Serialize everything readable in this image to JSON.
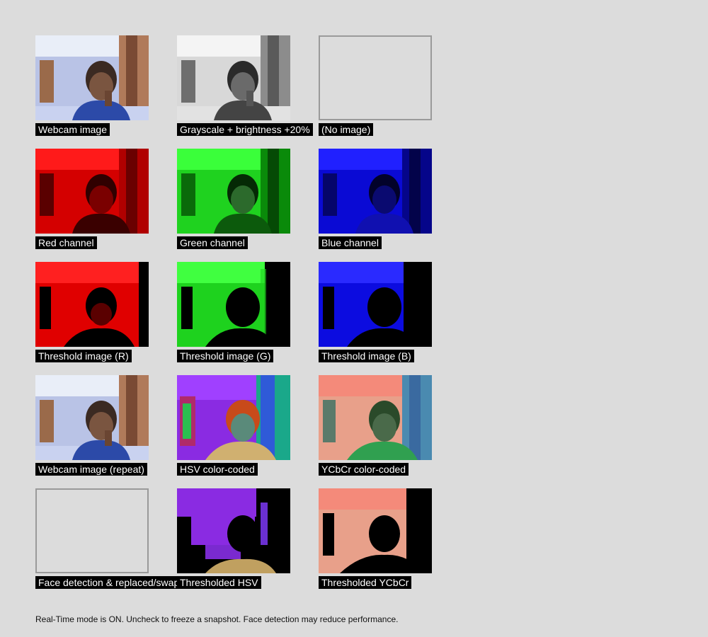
{
  "tiles": [
    {
      "caption": "Webcam image",
      "variant": "natural"
    },
    {
      "caption": "Grayscale + brightness +20%",
      "variant": "gray"
    },
    {
      "caption": "(No image)",
      "variant": "empty"
    },
    {
      "caption": "Red channel",
      "variant": "red"
    },
    {
      "caption": "Green channel",
      "variant": "green"
    },
    {
      "caption": "Blue channel",
      "variant": "blue"
    },
    {
      "caption": "Threshold image (R)",
      "variant": "thr-red"
    },
    {
      "caption": "Threshold image (G)",
      "variant": "thr-green"
    },
    {
      "caption": "Threshold image (B)",
      "variant": "thr-blue"
    },
    {
      "caption": "Webcam image (repeat)",
      "variant": "natural"
    },
    {
      "caption": "HSV color-coded",
      "variant": "hsv"
    },
    {
      "caption": "YCbCr color-coded",
      "variant": "ycbcr"
    },
    {
      "caption": "Face detection & replaced/swapped",
      "variant": "empty"
    },
    {
      "caption": "Thresholded HSV",
      "variant": "thr-hsv"
    },
    {
      "caption": "Thresholded YCbCr",
      "variant": "thr-ycbcr"
    }
  ],
  "footnote": "Real-Time mode is ON. Uncheck to freeze a snapshot. Face detection may reduce performance."
}
